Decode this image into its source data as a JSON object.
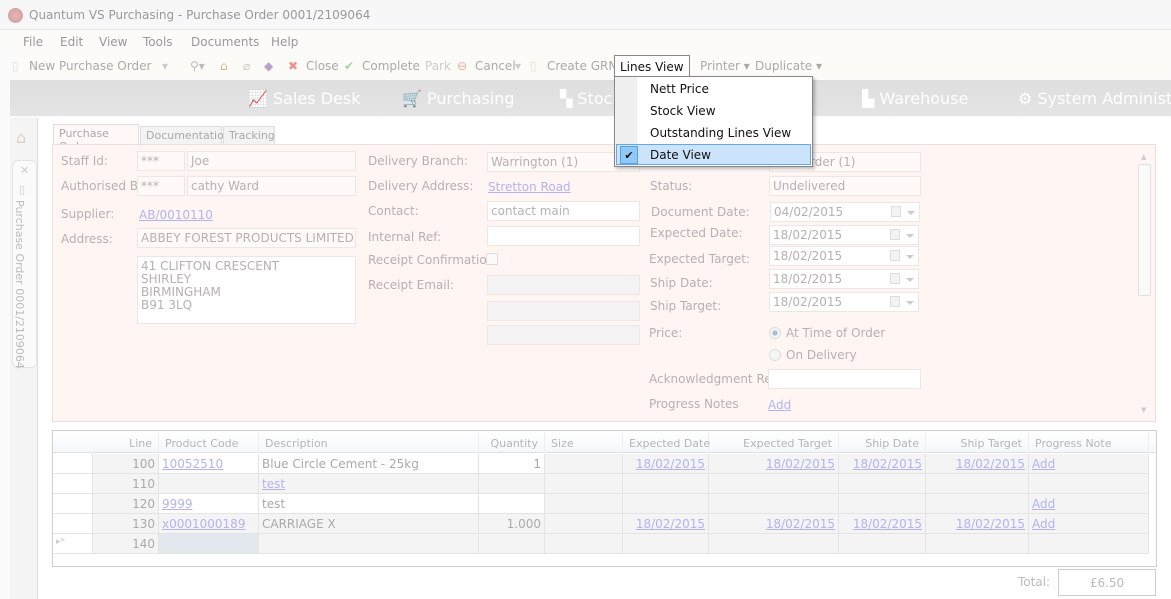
{
  "window": {
    "title": "Quantum VS Purchasing -  Purchase Order 0001/2109064"
  },
  "menu": [
    "File",
    "Edit",
    "View",
    "Tools",
    "Documents",
    "Help"
  ],
  "toolbar": {
    "new": "New",
    "new_type": "Purchase Order",
    "close": "Close",
    "complete": "Complete",
    "park": "Park",
    "cancel": "Cancel",
    "create_grn": "Create GRN",
    "lines_view": "Lines View",
    "printer": "Printer",
    "duplicate": "Duplicate"
  },
  "lines_view_menu": {
    "items": [
      "Nett Price",
      "Stock View",
      "Outstanding Lines View",
      "Date View"
    ],
    "checked": "Date View"
  },
  "nav": [
    "Sales Desk",
    "Purchasing",
    "Stock",
    "Warehouse",
    "System Administration"
  ],
  "side_tab": "Purchase Order 0001/2109064",
  "tabs": [
    "Purchase Order",
    "Documentation",
    "Tracking"
  ],
  "form": {
    "staff_id_label": "Staff Id:",
    "staff_id_code": "***",
    "staff_id_name": "Joe",
    "authorised_label": "Authorised By:",
    "authorised_code": "***",
    "authorised_name": "cathy Ward",
    "supplier_label": "Supplier:",
    "supplier": "AB/0010110",
    "address_label": "Address:",
    "address_name": "ABBEY FOREST PRODUCTS LIMITED",
    "address_lines": [
      "41 CLIFTON CRESCENT",
      "SHIRLEY",
      "BIRMINGHAM",
      "B91 3LQ"
    ],
    "delivery_branch_label": "Delivery Branch:",
    "delivery_branch": "Warrington (1)",
    "delivery_address_label": "Delivery Address:",
    "delivery_address": "Stretton Road",
    "contact_label": "Contact:",
    "contact": "contact main",
    "internal_ref_label": "Internal Ref:",
    "internal_ref": "",
    "receipt_confirmation_label": "Receipt Confirmation",
    "receipt_confirmation": false,
    "receipt_email_label": "Receipt Email:",
    "order_type_partial": "rder (1)",
    "status_label": "Status:",
    "status": "Undelivered",
    "document_date_label": "Document Date:",
    "document_date": "04/02/2015",
    "expected_date_label": "Expected Date:",
    "expected_date": "18/02/2015",
    "expected_target_label": "Expected Target:",
    "expected_target": "18/02/2015",
    "ship_date_label": "Ship Date:",
    "ship_date": "18/02/2015",
    "ship_target_label": "Ship Target:",
    "ship_target": "18/02/2015",
    "price_label": "Price:",
    "price_options": [
      "At Time of Order",
      "On Delivery"
    ],
    "price_selected": "At Time of Order",
    "ack_ref_label": "Acknowledgment Ref:",
    "ack_ref": "",
    "progress_notes_label": "Progress Notes",
    "progress_notes_link": "Add"
  },
  "grid": {
    "columns": [
      "Line",
      "Product Code",
      "Description",
      "Quantity",
      "Size",
      "Expected Date",
      "Expected Target",
      "Ship Date",
      "Ship Target",
      "Progress Note"
    ],
    "rows": [
      {
        "icon": "box-icon",
        "line": "100",
        "code": "10052510",
        "desc": "Blue Circle Cement - 25kg",
        "desc_link": false,
        "qty": "1",
        "size": "",
        "exp": "18/02/2015",
        "expt": "18/02/2015",
        "ship": "18/02/2015",
        "shipt": "18/02/2015",
        "note": "Add"
      },
      {
        "icon": "pencil-icon",
        "line": "110",
        "code": "",
        "desc": "test",
        "desc_link": true,
        "qty": "",
        "size": "",
        "exp": "",
        "expt": "",
        "ship": "",
        "shipt": "",
        "note": ""
      },
      {
        "icon": "hand-icon",
        "line": "120",
        "code": "9999",
        "desc": "test",
        "desc_link": false,
        "qty": "",
        "size": "",
        "exp": "",
        "expt": "",
        "ship": "",
        "shipt": "",
        "note": "Add"
      },
      {
        "icon": "gear-icon",
        "line": "130",
        "code": "x0001000189",
        "desc": "CARRIAGE X",
        "desc_link": false,
        "qty": "1.000",
        "size": "",
        "exp": "18/02/2015",
        "expt": "18/02/2015",
        "ship": "18/02/2015",
        "shipt": "18/02/2015",
        "note": "Add"
      },
      {
        "icon": "",
        "line": "140",
        "code": "",
        "desc": "",
        "desc_link": false,
        "qty": "",
        "size": "",
        "exp": "",
        "expt": "",
        "ship": "",
        "shipt": "",
        "note": "",
        "new_row": true
      }
    ]
  },
  "total": {
    "label": "Total:",
    "value": "£6.50"
  }
}
